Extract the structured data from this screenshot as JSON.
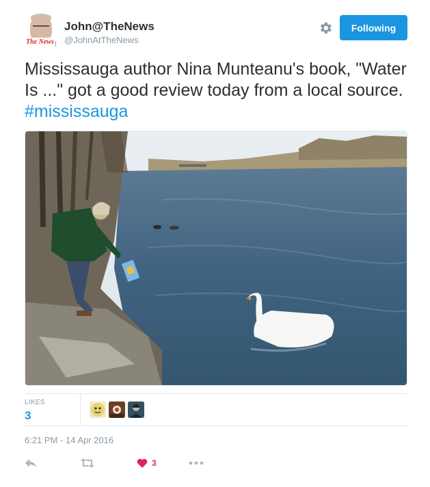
{
  "author": {
    "name": "John@TheNews",
    "handle": "@JohnAtTheNews",
    "avatar_brand": "The News"
  },
  "header": {
    "follow_label": "Following",
    "settings_icon": "gear-icon"
  },
  "tweet": {
    "text_main": "Mississauga author Nina Munteanu's book, \"Water Is ...\" got a good review today from a local source. ",
    "hashtag": "#mississauga"
  },
  "stats": {
    "likes_label": "LIKES",
    "likes_count": "3"
  },
  "timestamp": "6:21 PM - 14 Apr 2016",
  "actions": {
    "reply_icon": "reply-icon",
    "retweet_icon": "retweet-icon",
    "like_icon": "heart-icon",
    "like_count": "3",
    "more_icon": "more-icon"
  },
  "colors": {
    "accent": "#1b95e0",
    "like": "#e0245e",
    "muted": "#8899a6",
    "text": "#292f33",
    "border": "#e1e8ed"
  }
}
